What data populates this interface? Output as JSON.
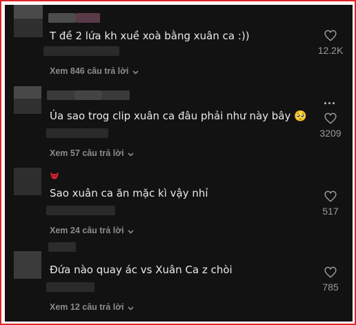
{
  "comments": [
    {
      "text": "T đề 2 lứa kh xuề xoà bằng xuân ca :))",
      "likes": "12.2K",
      "replies": "Xem 846 câu trả lời"
    },
    {
      "text": "Úa sao trog clip xuân ca đâu phải như này bây",
      "text_emoji": "🥺",
      "likes": "3209",
      "replies": "Xem 57 câu trả lời",
      "more_label": "..."
    },
    {
      "badge_icon": "red-devil-emoji-icon",
      "text": "Sao xuân ca ăn mặc kì vậy nhỉ",
      "likes": "517",
      "replies": "Xem 24 câu trả lời"
    },
    {
      "text": "Đứa nào quay ác vs Xuân Ca z chòi",
      "likes": "785",
      "replies": "Xem 12 câu trả lời"
    }
  ],
  "colors": {
    "frame_border": "#e0242b",
    "background": "#121212",
    "text": "#e9e9e9",
    "muted": "#8c8c8c"
  }
}
